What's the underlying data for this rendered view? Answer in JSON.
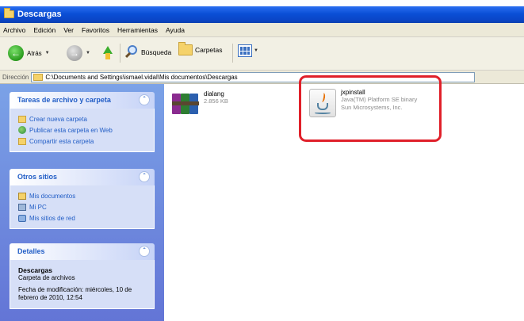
{
  "window": {
    "title": "Descargas"
  },
  "menu": [
    "Archivo",
    "Edición",
    "Ver",
    "Favoritos",
    "Herramientas",
    "Ayuda"
  ],
  "toolbar": {
    "back_label": "Atrás",
    "search_label": "Búsqueda",
    "folders_label": "Carpetas"
  },
  "address": {
    "label": "Dirección",
    "path": "C:\\Documents and Settings\\ismael.vidal\\Mis documentos\\Descargas"
  },
  "tasks_panel": {
    "title": "Tareas de archivo y carpeta",
    "items": [
      "Crear nueva carpeta",
      "Publicar esta carpeta en Web",
      "Compartir esta carpeta"
    ]
  },
  "places_panel": {
    "title": "Otros sitios",
    "items": [
      "Mis documentos",
      "Mi PC",
      "Mis sitios de red"
    ]
  },
  "details_panel": {
    "title": "Detalles",
    "name": "Descargas",
    "type": "Carpeta de archivos",
    "modified": "Fecha de modificación: miércoles, 10 de febrero de 2010, 12:54"
  },
  "files": [
    {
      "name": "dialang",
      "detail1": "2.856 KB",
      "icon": "winrar-archive-icon"
    },
    {
      "name": "jxpinstall",
      "detail1": "Java(TM) Platform SE binary",
      "detail2": "Sun Microsystems, Inc.",
      "icon": "java-icon"
    }
  ],
  "colors": {
    "titlebar": "#0a4fd6",
    "sidebar": "#7ba2e7",
    "link": "#215dc6",
    "highlight": "#e0202a"
  }
}
